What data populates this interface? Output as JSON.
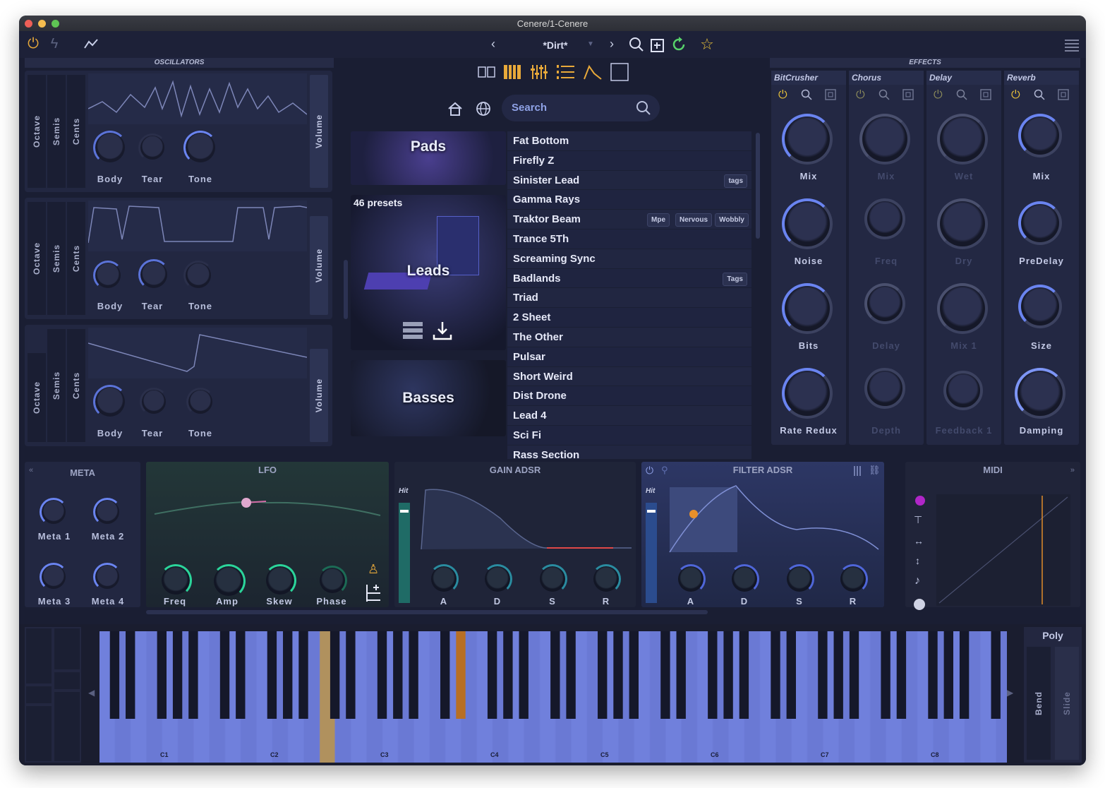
{
  "window": {
    "title": "Cenere/1-Cenere"
  },
  "toolbar": {
    "preset": "*Dirt*",
    "prev": "‹",
    "next": "›"
  },
  "oscillators": {
    "title": "OSCILLATORS",
    "rows": [
      {
        "labels": [
          "Octave",
          "Semis",
          "Cents"
        ],
        "knobs": [
          "Body",
          "Tear",
          "Tone"
        ],
        "volume": "Volume"
      },
      {
        "labels": [
          "Octave",
          "Semis",
          "Cents"
        ],
        "knobs": [
          "Body",
          "Tear",
          "Tone"
        ],
        "volume": "Volume"
      },
      {
        "labels": [
          "Octave",
          "Semis",
          "Cents"
        ],
        "knobs": [
          "Body",
          "Tear",
          "Tone"
        ],
        "volume": "Volume"
      }
    ]
  },
  "browser": {
    "search_placeholder": "Search",
    "categories": [
      {
        "name": "Pads"
      },
      {
        "name": "Leads",
        "count": "46 presets"
      },
      {
        "name": "Basses"
      }
    ],
    "presets": [
      {
        "name": "Fat Bottom",
        "tags": []
      },
      {
        "name": "Firefly Z",
        "tags": []
      },
      {
        "name": "Sinister Lead",
        "tags": [
          "tags"
        ]
      },
      {
        "name": "Gamma Rays",
        "tags": []
      },
      {
        "name": "Traktor Beam",
        "tags": [
          "Mpe",
          "Nervous",
          "Wobbly"
        ]
      },
      {
        "name": "Trance 5Th",
        "tags": []
      },
      {
        "name": "Screaming Sync",
        "tags": []
      },
      {
        "name": "Badlands",
        "tags": [
          "Tags"
        ]
      },
      {
        "name": "Triad",
        "tags": []
      },
      {
        "name": "2 Sheet",
        "tags": []
      },
      {
        "name": "The Other",
        "tags": []
      },
      {
        "name": "Pulsar",
        "tags": []
      },
      {
        "name": "Short Weird",
        "tags": []
      },
      {
        "name": "Dist Drone",
        "tags": []
      },
      {
        "name": "Lead 4",
        "tags": []
      },
      {
        "name": "Sci Fi",
        "tags": []
      },
      {
        "name": "Rass Section",
        "tags": []
      }
    ]
  },
  "effects": {
    "title": "EFFECTS",
    "units": [
      {
        "name": "BitCrusher",
        "knobs": [
          "Mix",
          "Noise",
          "Bits",
          "Rate Redux"
        ],
        "enabled": true
      },
      {
        "name": "Chorus",
        "knobs": [
          "Mix",
          "Freq",
          "Delay",
          "Depth"
        ],
        "enabled": false
      },
      {
        "name": "Delay",
        "knobs": [
          "Wet",
          "Dry",
          "Mix 1",
          "Feedback 1"
        ],
        "enabled": false
      },
      {
        "name": "Reverb",
        "knobs": [
          "Mix",
          "PreDelay",
          "Size",
          "Damping"
        ],
        "enabled": true
      }
    ]
  },
  "meta": {
    "title": "META",
    "knobs": [
      "Meta 1",
      "Meta 2",
      "Meta 3",
      "Meta 4"
    ]
  },
  "lfo": {
    "title": "LFO",
    "knobs": [
      "Freq",
      "Amp",
      "Skew",
      "Phase"
    ]
  },
  "gain_adsr": {
    "title": "GAIN ADSR",
    "hit": "Hit",
    "knobs": [
      "A",
      "D",
      "S",
      "R"
    ]
  },
  "filter_adsr": {
    "title": "FILTER ADSR",
    "hit": "Hit",
    "knobs": [
      "A",
      "D",
      "S",
      "R"
    ]
  },
  "midi": {
    "title": "MIDI"
  },
  "keyboard": {
    "octaves": [
      "C1",
      "C2",
      "C3",
      "C4",
      "C5",
      "C6",
      "C7",
      "C8"
    ],
    "mode": "Poly",
    "bend": "Bend",
    "slide": "Slide"
  },
  "colors": {
    "accent": "#e8a93a",
    "knob_blue": "#5b73d8",
    "lfo_green": "#2bd49a",
    "keys": "#6d7cd8"
  }
}
